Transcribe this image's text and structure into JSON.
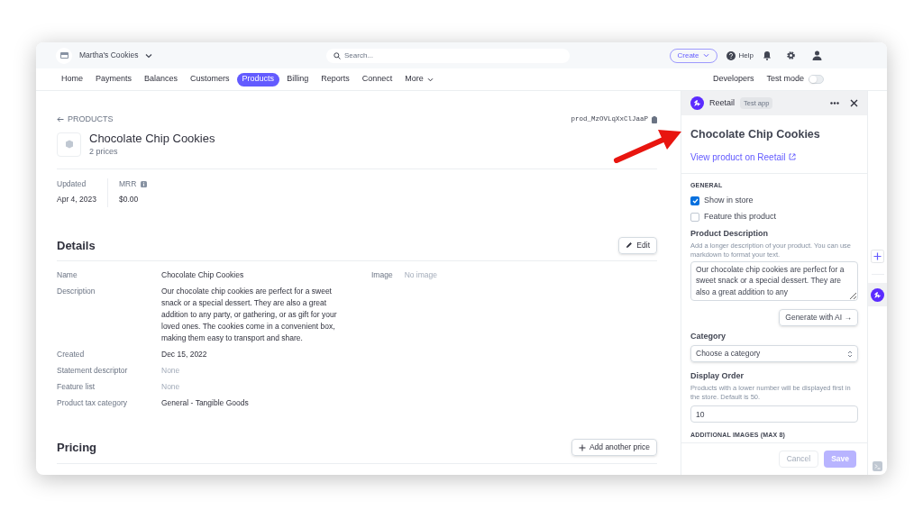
{
  "account": {
    "name": "Martha's Cookies"
  },
  "search": {
    "placeholder": "Search..."
  },
  "top_actions": {
    "create": "Create",
    "help": "Help"
  },
  "nav": {
    "items": [
      {
        "label": "Home",
        "selected": false
      },
      {
        "label": "Payments",
        "selected": false
      },
      {
        "label": "Balances",
        "selected": false
      },
      {
        "label": "Customers",
        "selected": false
      },
      {
        "label": "Products",
        "selected": true
      },
      {
        "label": "Billing",
        "selected": false
      },
      {
        "label": "Reports",
        "selected": false
      },
      {
        "label": "Connect",
        "selected": false
      }
    ],
    "more": "More",
    "developers": "Developers",
    "test_mode": {
      "label": "Test mode",
      "on": false
    }
  },
  "product": {
    "back": "PRODUCTS",
    "id": "prod_MzOVLqXxClJaaP",
    "title": "Chocolate Chip Cookies",
    "subtitle": "2 prices",
    "stats": [
      {
        "label": "Updated",
        "value": "Apr 4, 2023",
        "info": false
      },
      {
        "label": "MRR",
        "value": "$0.00",
        "info": true
      }
    ],
    "details": {
      "title": "Details",
      "edit": "Edit",
      "image_label": "Image",
      "image_value": "No image",
      "rows": [
        {
          "label": "Name",
          "value": "Chocolate Chip Cookies",
          "empty": false
        },
        {
          "label": "Description",
          "value": "Our chocolate chip cookies are perfect for a sweet snack or a special dessert. They are also a great addition to any party, or gathering, or as gift for your loved ones. The cookies come in a convenient box, making them easy to transport and share.",
          "empty": false
        },
        {
          "label": "Created",
          "value": "Dec 15, 2022",
          "empty": false
        },
        {
          "label": "Statement descriptor",
          "value": "None",
          "empty": true
        },
        {
          "label": "Feature list",
          "value": "None",
          "empty": true
        },
        {
          "label": "Product tax category",
          "value": "General - Tangible Goods",
          "empty": false
        }
      ]
    },
    "pricing": {
      "title": "Pricing",
      "add": "Add another price"
    }
  },
  "panel": {
    "app_name": "Reetail",
    "badge": "Test app",
    "title": "Chocolate Chip Cookies",
    "link": "View product on Reetail",
    "section": "GENERAL",
    "checkboxes": [
      {
        "label": "Show in store",
        "checked": true
      },
      {
        "label": "Feature this product",
        "checked": false
      }
    ],
    "description": {
      "label": "Product Description",
      "help": "Add a longer description of your product. You can use markdown to format your text.",
      "value": "Our chocolate chip cookies are perfect for a sweet snack or a special dessert. They are also a great addition to any",
      "generate": "Generate with AI →"
    },
    "category": {
      "label": "Category",
      "value": "Choose a category"
    },
    "order": {
      "label": "Display Order",
      "help": "Products with a lower number will be displayed first in the store. Default is 50.",
      "value": "10"
    },
    "images": "ADDITIONAL IMAGES (MAX 8)",
    "cancel": "Cancel",
    "save": "Save"
  }
}
